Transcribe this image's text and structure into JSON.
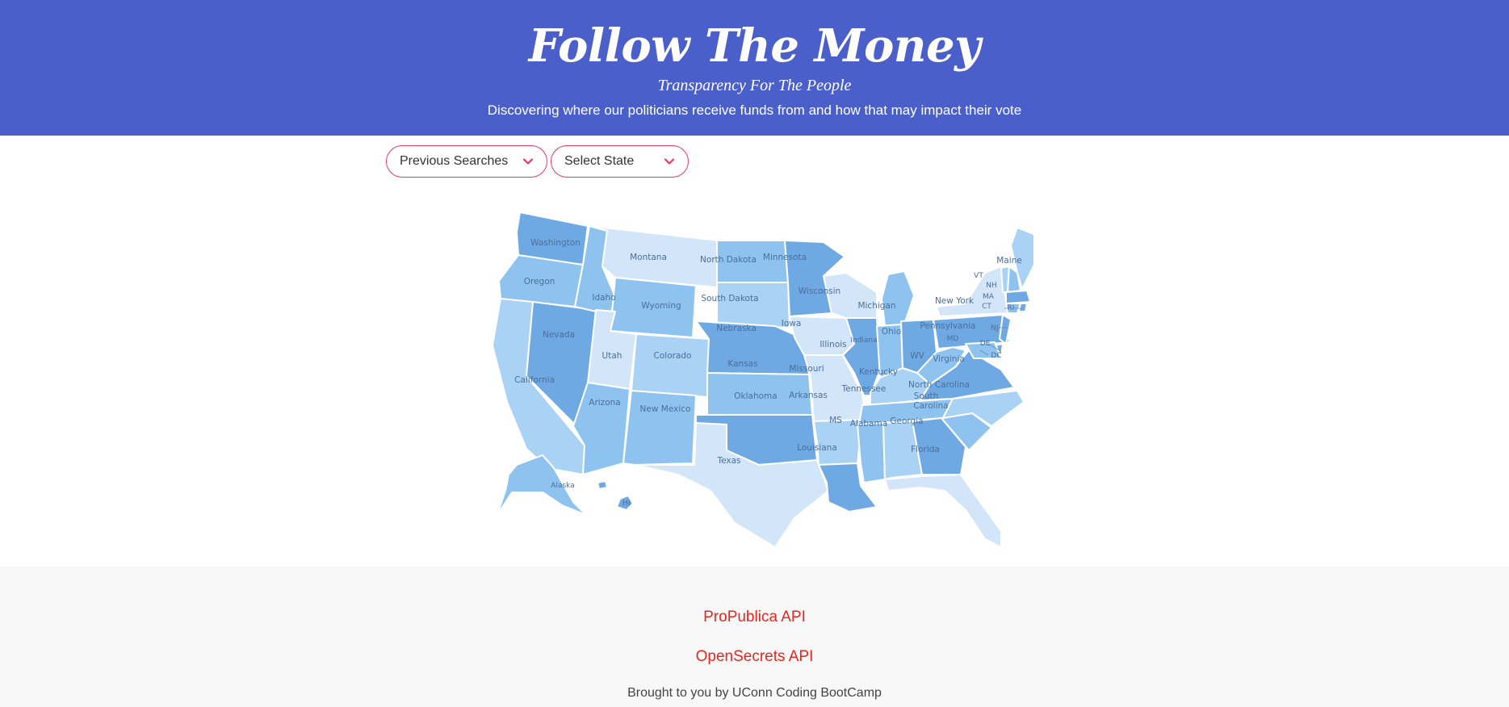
{
  "header": {
    "title": "Follow The Money",
    "subtitle": "Transparency For The People",
    "tagline": "Discovering where our politicians receive funds from and how that may impact their vote"
  },
  "controls": {
    "previous_searches": "Previous Searches",
    "select_state": "Select State"
  },
  "colors": {
    "header_bg": "#4a5fc9",
    "dropdown_border": "#e8395f",
    "link": "#e8251e",
    "shade_1": "#d3e6f9",
    "shade_2": "#a9d2f5",
    "shade_3": "#8ec3f0",
    "shade_4": "#6fa9e3"
  },
  "map": {
    "states": {
      "washington": "Washington",
      "oregon": "Oregon",
      "california": "California",
      "nevada": "Nevada",
      "idaho": "Idaho",
      "montana": "Montana",
      "wyoming": "Wyoming",
      "utah": "Utah",
      "colorado": "Colorado",
      "arizona": "Arizona",
      "new_mexico": "New Mexico",
      "north_dakota": "North Dakota",
      "south_dakota": "South Dakota",
      "nebraska": "Nebraska",
      "kansas": "Kansas",
      "oklahoma": "Oklahoma",
      "texas": "Texas",
      "minnesota": "Minnesota",
      "iowa": "Iowa",
      "missouri": "Missouri",
      "arkansas": "Arkansas",
      "louisiana": "Louisiana",
      "wisconsin": "Wisconsin",
      "illinois": "Illinois",
      "michigan": "Michigan",
      "indiana": "Indiana",
      "ohio": "Ohio",
      "kentucky": "Kentucky",
      "tennessee": "Tennessee",
      "mississippi": "MS",
      "alabama": "Alabama",
      "georgia": "Georgia",
      "florida": "Florida",
      "south_carolina_1": "South",
      "south_carolina_2": "Carolina",
      "north_carolina": "North Carolina",
      "virginia": "Virginia",
      "west_virginia": "WV",
      "pennsylvania": "Pennsylvania",
      "new_york": "New York",
      "vermont": "VT",
      "new_hampshire": "NH",
      "maine": "Maine",
      "massachusetts": "MA",
      "connecticut": "CT",
      "rhode_island": "RI",
      "new_jersey": "NJ",
      "delaware": "DE",
      "maryland": "MD",
      "dc": "DC",
      "alaska": "Alaska",
      "hawaii": "HI"
    }
  },
  "footer": {
    "link_1": "ProPublica API",
    "link_2": "OpenSecrets API",
    "credit": "Brought to you by UConn Coding BootCamp"
  }
}
